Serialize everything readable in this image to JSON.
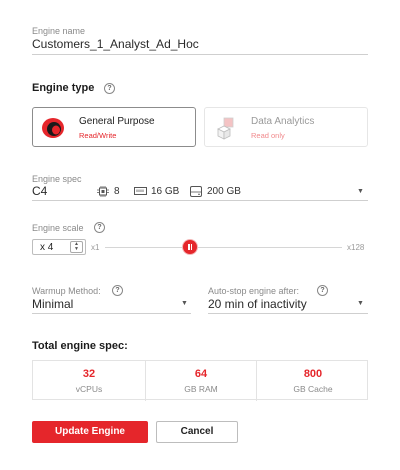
{
  "engine_name": {
    "label": "Engine name",
    "value": "Customers_1_Analyst_Ad_Hoc"
  },
  "engine_type": {
    "title": "Engine type",
    "help_icon": "?",
    "options": [
      {
        "title": "General Purpose",
        "subtitle": "Read/Write",
        "selected": true,
        "icon": "general-purpose-icon"
      },
      {
        "title": "Data Analytics",
        "subtitle": "Read only",
        "selected": false,
        "icon": "data-analytics-icon"
      }
    ]
  },
  "engine_spec": {
    "label": "Engine spec",
    "value": "C4",
    "cpu": "8",
    "ram": "16 GB",
    "disk": "200 GB",
    "icons": [
      "cpu-icon",
      "ram-icon",
      "disk-icon"
    ]
  },
  "engine_scale": {
    "label": "Engine scale",
    "help_icon": "?",
    "stepper_value": "x 4",
    "slider_min": "x1",
    "slider_max": "x128",
    "slider_level": 0.36
  },
  "warmup": {
    "label": "Warmup Method:",
    "help_icon": "?",
    "value": "Minimal"
  },
  "autostop": {
    "label": "Auto-stop engine after:",
    "help_icon": "?",
    "value": "20 min of inactivity"
  },
  "total": {
    "title": "Total engine spec:",
    "cells": [
      {
        "value": "32",
        "unit": "vCPUs"
      },
      {
        "value": "64",
        "unit": "GB RAM"
      },
      {
        "value": "800",
        "unit": "GB Cache"
      }
    ]
  },
  "buttons": {
    "update": "Update Engine",
    "cancel": "Cancel"
  },
  "colors": {
    "accent": "#e5262b",
    "border": "#cfcfcf",
    "muted": "#8a8a8a"
  }
}
